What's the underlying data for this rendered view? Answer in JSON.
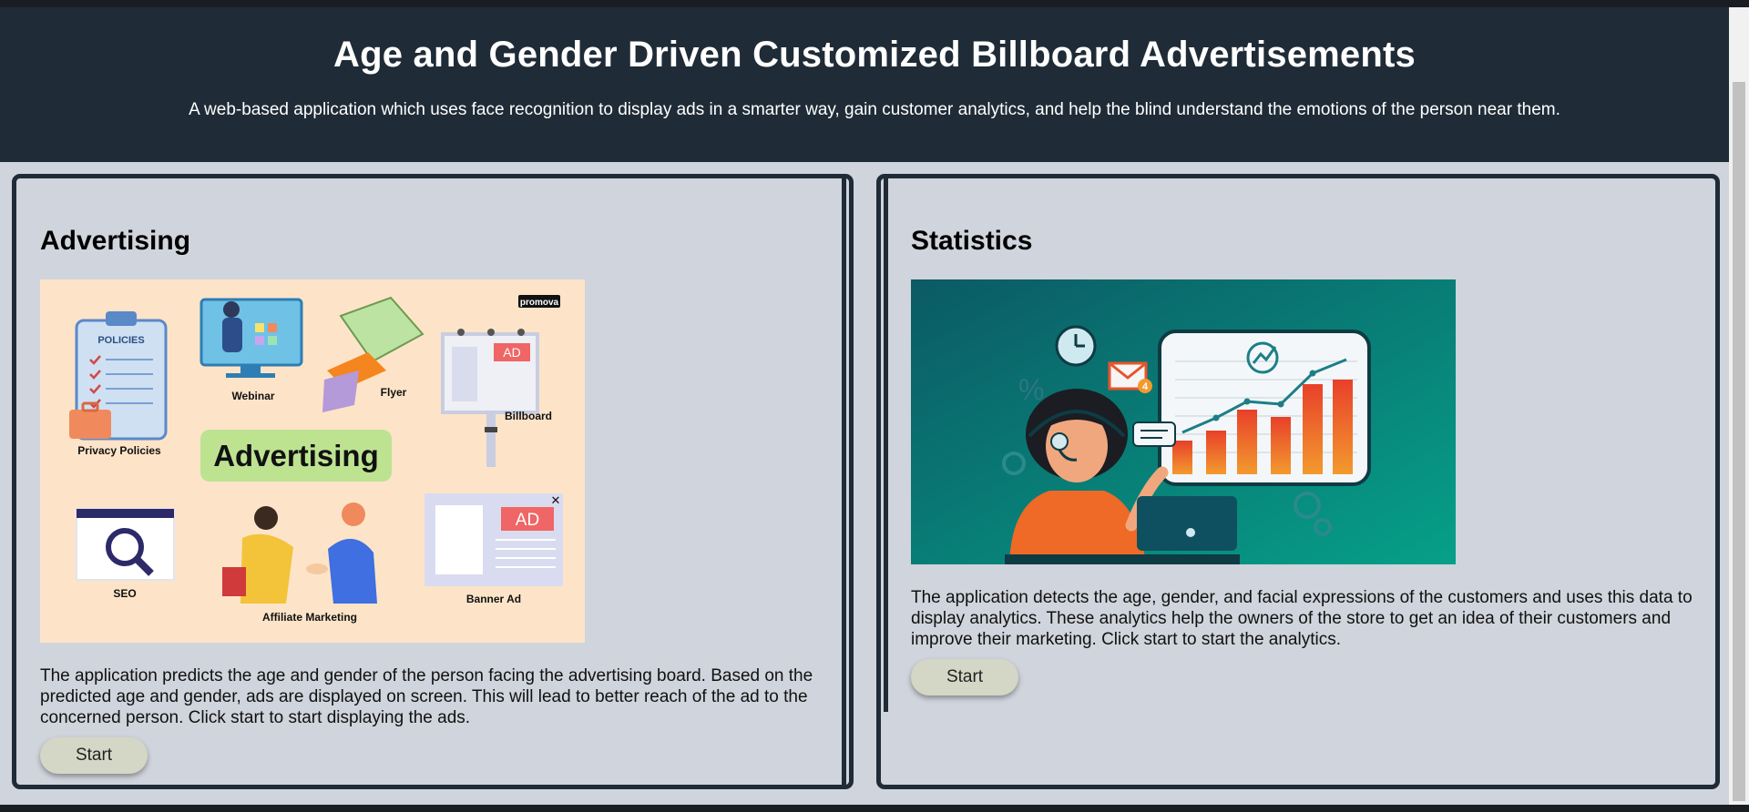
{
  "header": {
    "title": "Age and Gender Driven Customized Billboard Advertisements",
    "subtitle": "A web-based application which uses face recognition to display ads in a smarter way, gain customer analytics, and help the blind understand the emotions of the person near them."
  },
  "advertising": {
    "title": "Advertising",
    "image": {
      "brand": "promova",
      "center_label": "Advertising",
      "labels": {
        "policies_board": "POLICIES",
        "privacy": "Privacy Policies",
        "webinar": "Webinar",
        "flyer": "Flyer",
        "billboard": "Billboard",
        "ad": "AD",
        "seo": "SEO",
        "affiliate": "Affiliate Marketing",
        "banner": "Banner Ad",
        "close": "✕"
      }
    },
    "description": "The application predicts the age and gender of the person facing the advertising board. Based on the predicted age and gender, ads are displayed on screen. This will lead to better reach of the ad to the concerned person. Click start to start displaying the ads.",
    "start_label": "Start"
  },
  "statistics": {
    "title": "Statistics",
    "image": {
      "percent_sign": "%",
      "mail_badge": "4"
    },
    "description": "The application detects the age, gender, and facial expressions of the customers and uses this data to display analytics. These analytics help the owners of the store to get an idea of their customers and improve their marketing. Click start to start the analytics.",
    "start_label": "Start"
  },
  "colors": {
    "header_bg": "#1f2b36",
    "page_bg": "#d0d4dc",
    "button_bg": "#d4d7c6"
  }
}
